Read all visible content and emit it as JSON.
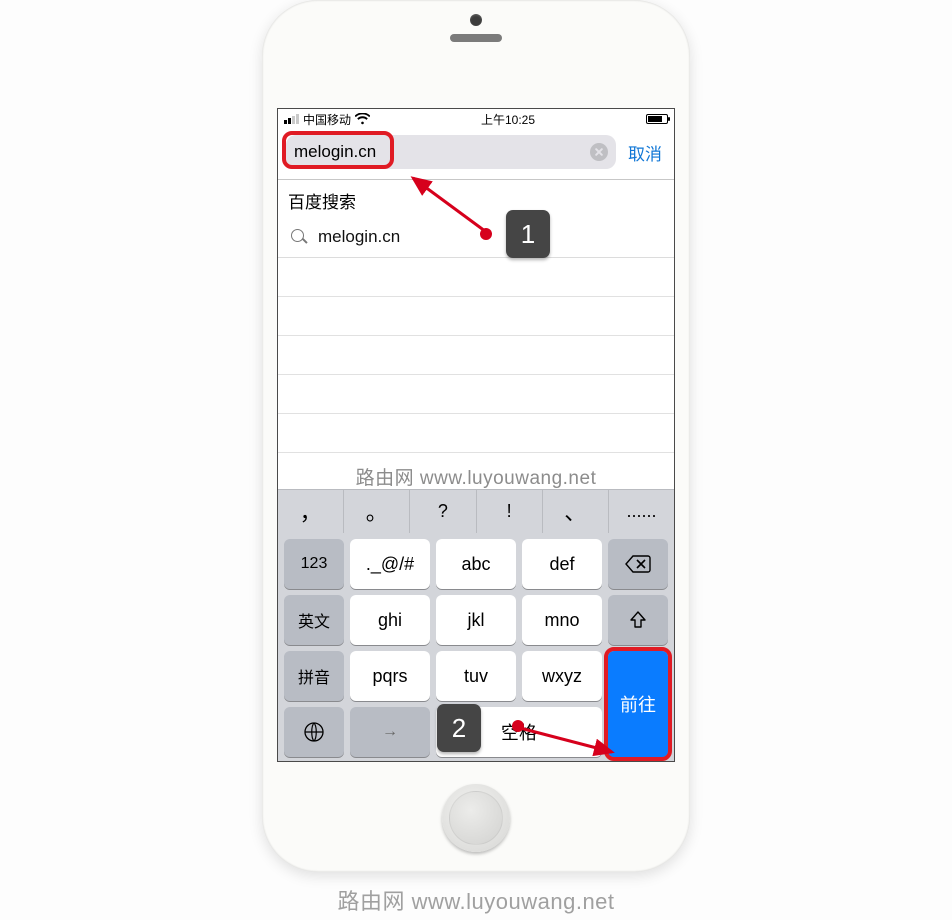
{
  "status": {
    "carrier": "中国移动",
    "time": "上午10:25"
  },
  "url_bar": {
    "value": "melogin.cn",
    "cancel": "取消"
  },
  "suggestions": {
    "header": "百度搜索",
    "item1": "melogin.cn"
  },
  "watermark": {
    "inside": "路由网 www.luyouwang.net",
    "outside": "路由网  www.luyouwang.net"
  },
  "punct": {
    "p1": "，",
    "p2": "。",
    "p3": "?",
    "p4": "!",
    "p5": "、",
    "p6": "......"
  },
  "keys": {
    "r1c1": "123",
    "r1c2": "._@/#",
    "r1c3": "abc",
    "r1c4": "def",
    "r2c1": "英文",
    "r2c2": "ghi",
    "r2c3": "jkl",
    "r2c4": "mno",
    "r3c1": "拼音",
    "r3c2": "pqrs",
    "r3c3": "tuv",
    "r3c4": "wxyz",
    "space": "空格",
    "go": "前往",
    "next": "→"
  },
  "annot": {
    "b1": "1",
    "b2": "2"
  }
}
